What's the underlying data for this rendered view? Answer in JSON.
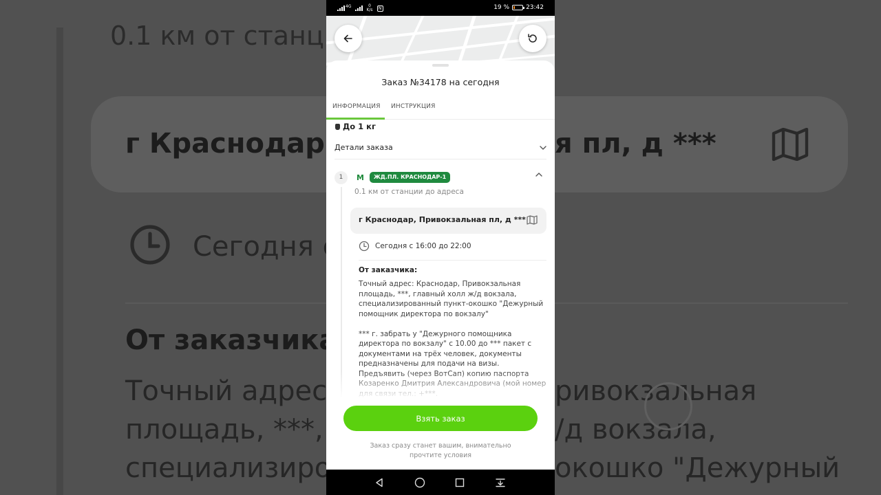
{
  "background": {
    "distance": "0.1 км от станц",
    "address_left": "г Краснодар,",
    "address_right": "я пл, д ***",
    "today": "Сегодня с",
    "from": "От заказчика",
    "line1_left": "Точный адрес",
    "line1_right": "ривокзальная",
    "line2_left": "площадь, ***, ",
    "line2_right": "/д вокзала,",
    "line3_left": "специализиро",
    "line3_right": "окошко \"Дежурный"
  },
  "status_bar": {
    "network": "4G",
    "speed_value": "0",
    "speed_unit": "K/s",
    "battery": "19 %",
    "battery_level": 0.19,
    "time": "23:42"
  },
  "order": {
    "title": "Заказ №34178 на сегодня",
    "tabs": [
      {
        "label": "ИНФОРМАЦИЯ",
        "active": true
      },
      {
        "label": "ИНСТРУКЦИЯ",
        "active": false
      }
    ],
    "weight": "До 1 кг",
    "details_label": "Детали заказа",
    "step": {
      "number": "1",
      "metro_symbol": "M",
      "station": "ЖД.ПЛ. КРАСНОДАР-1",
      "distance": "0.1 км от станции до адреса",
      "address": "г Краснодар, Привокзальная пл, д ***",
      "time_window": "Сегодня с 16:00 до 22:00",
      "from_customer_title": "От заказчика:",
      "comment": "Точный адрес: Краснодар, Привокзальная площадь, ***, главный холл ж/д вокзала, специализированный пункт-окошко \"Дежурный помощник директора по вокзалу\"\n\n*** г. забрать у \"Дежурного помощника директора по вокзалу\" с 10.00 до *** пакет с документами на трёх человек, документы предназначены для подачи на визы. Предъявить (через ВотСап) копию паспорта Козаренко Дмитрия Александровича (мой номер для связи тел.: +***."
    }
  },
  "actions": {
    "take_order": "Взять заказ",
    "hint": "Заказ сразу станет вашим, внимательно прочтите условия"
  },
  "colors": {
    "accent_green": "#5bd10f",
    "station_green": "#1f8a3f",
    "tab_underline": "#6ac73c"
  },
  "icons": {
    "back": "arrow-left-icon",
    "refresh": "refresh-icon",
    "weight": "weight-icon",
    "details": "chevron-down-icon",
    "collapse": "chevron-up-icon",
    "metro": "metro-icon",
    "map": "map-icon",
    "clock": "clock-icon"
  }
}
